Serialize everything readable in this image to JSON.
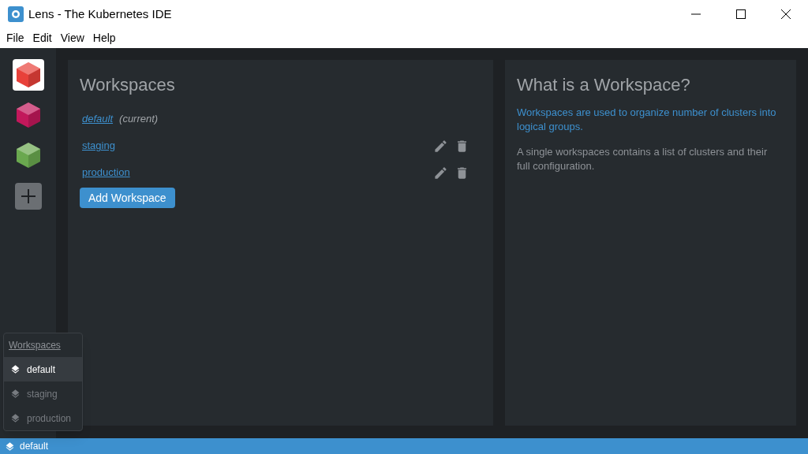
{
  "window": {
    "title": "Lens - The Kubernetes IDE"
  },
  "menu": [
    "File",
    "Edit",
    "View",
    "Help"
  ],
  "clusters": [
    {
      "color": "#e8413a",
      "selected": true
    },
    {
      "color": "#c2185b",
      "selected": false
    },
    {
      "color": "#6aa84f",
      "selected": false
    }
  ],
  "workspaces_panel": {
    "title": "Workspaces",
    "items": [
      {
        "name": "default",
        "note": "(current)",
        "editable": false
      },
      {
        "name": "staging",
        "editable": true
      },
      {
        "name": "production",
        "editable": true
      }
    ],
    "add_button": "Add Workspace"
  },
  "info_panel": {
    "title": "What is a Workspace?",
    "highlight": "Workspaces are used to organize number of clusters into logical groups.",
    "text": "A single workspaces contains a list of clusters and their full configuration."
  },
  "workspace_menu": {
    "title": "Workspaces",
    "items": [
      {
        "label": "default",
        "selected": true
      },
      {
        "label": "staging",
        "selected": false
      },
      {
        "label": "production",
        "selected": false
      }
    ]
  },
  "status_bar": {
    "workspace": "default"
  }
}
